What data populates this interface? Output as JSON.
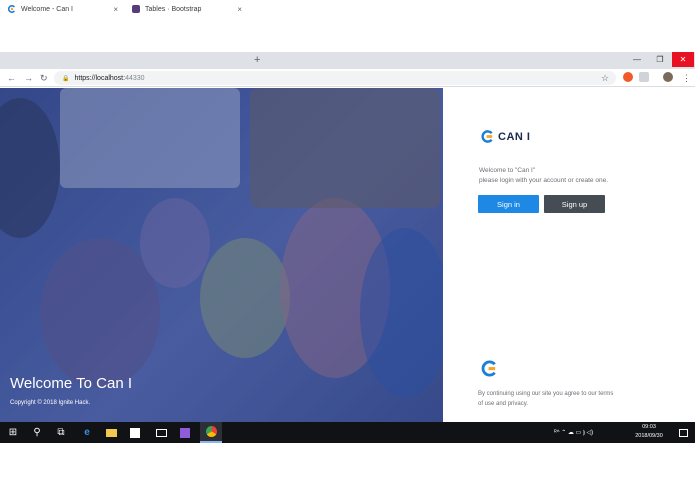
{
  "browser": {
    "tabs": [
      {
        "title": "Welcome - Can I",
        "close": "×",
        "favicon": "can-i-logo-icon"
      },
      {
        "title": "Tables · Bootstrap",
        "close": "×",
        "favicon": "bootstrap-icon"
      }
    ],
    "new_tab": "+",
    "window_controls": {
      "minimize": "—",
      "restore": "❐",
      "close": "✕"
    },
    "nav": {
      "back": "←",
      "forward": "→",
      "reload": "↻"
    },
    "address": {
      "lock": "🔒",
      "scheme_host": "https://localhost:",
      "port": "44330"
    },
    "star": "☆"
  },
  "hero": {
    "title": "Welcome To Can I",
    "copyright": "Copyright © 2018 Ignite Hack."
  },
  "panel": {
    "brand": "CAN I",
    "welcome_line1": "Welcome to \"Can I\"",
    "welcome_line2": "please login with your account or create one.",
    "signin": "Sign in",
    "signup": "Sign up",
    "terms_line1": "By continuing using our site you agree to our terms",
    "terms_line2": "of use and privacy."
  },
  "taskbar": {
    "start": "⊞",
    "search": "⚲",
    "taskview": "⧉",
    "clock_time": "09:03",
    "clock_date": "2018/09/30",
    "tray_text": "ᴿ^  ⌃ ☁ ▭ ⦘ ◁)"
  },
  "colors": {
    "accent": "#1e88e5",
    "secondary_button": "#454c54",
    "brand_orange": "#f5a623",
    "brand_dark": "#1b2a4a"
  }
}
